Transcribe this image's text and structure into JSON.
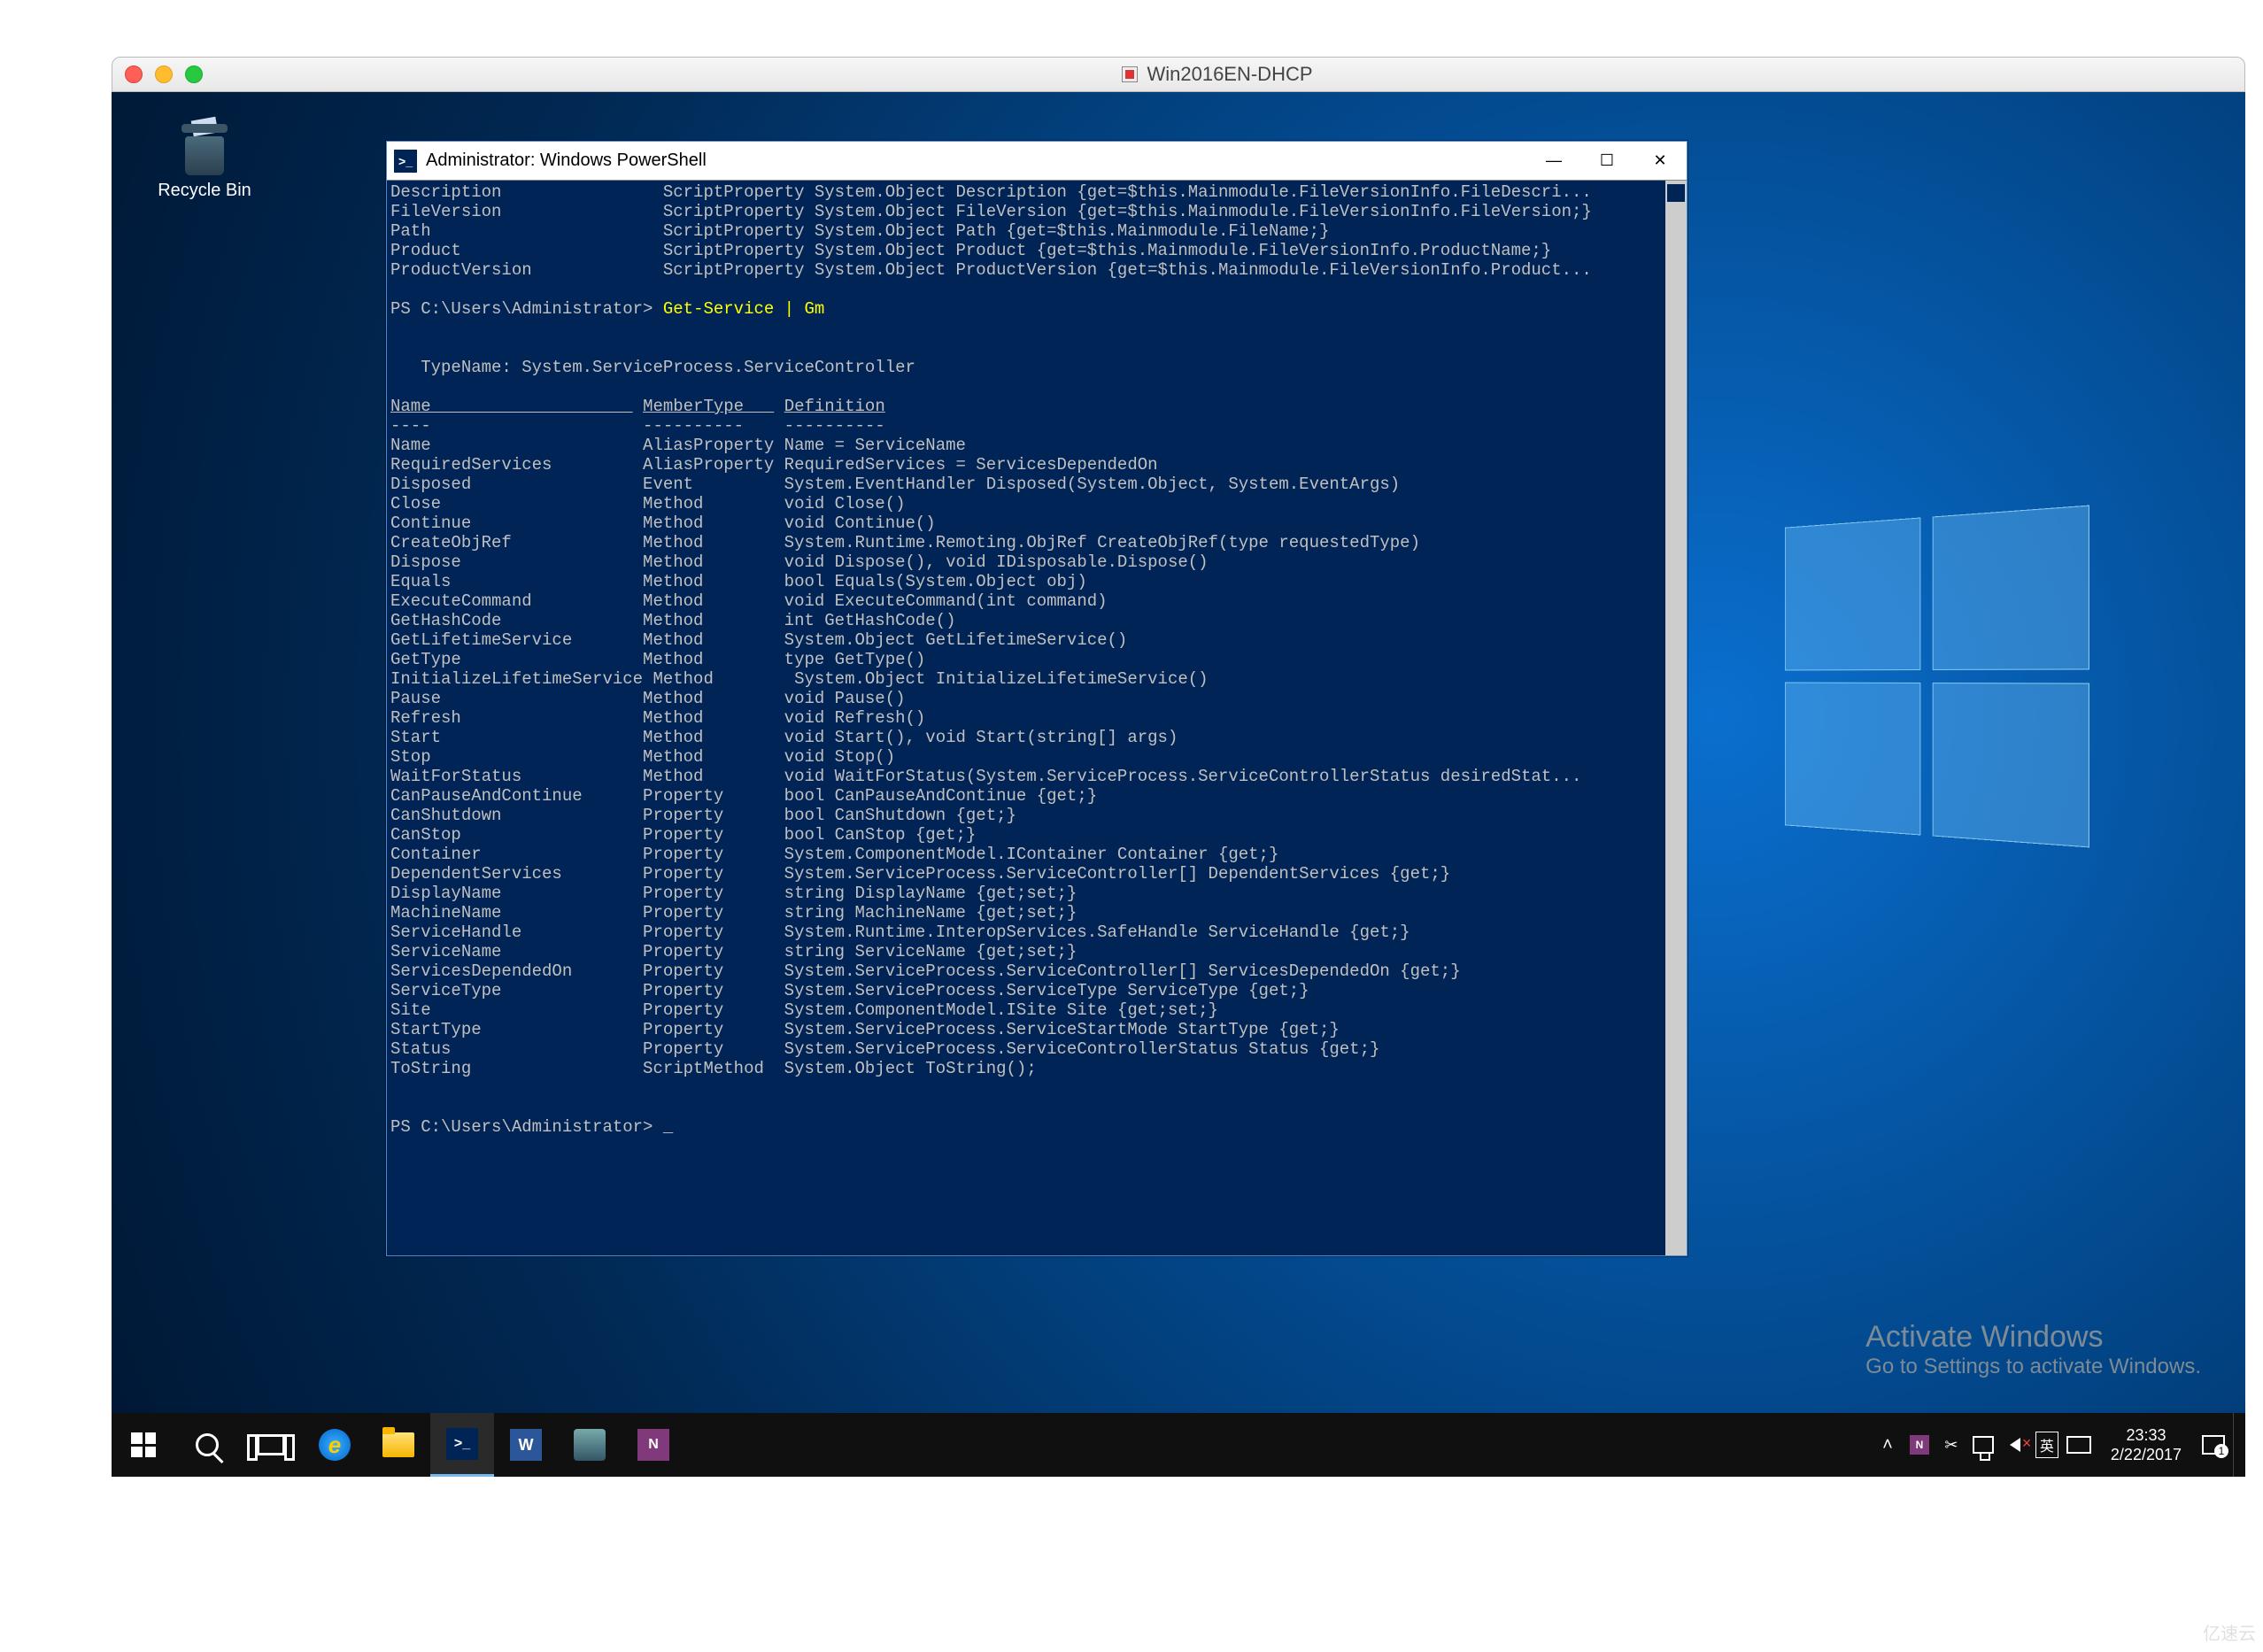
{
  "mac": {
    "title": "Win2016EN-DHCP"
  },
  "desktop": {
    "recycle_bin_label": "Recycle Bin"
  },
  "powershell": {
    "title": "Administrator: Windows PowerShell",
    "top_output": [
      {
        "name": "Description",
        "member": "ScriptProperty",
        "def": "System.Object Description {get=$this.Mainmodule.FileVersionInfo.FileDescri..."
      },
      {
        "name": "FileVersion",
        "member": "ScriptProperty",
        "def": "System.Object FileVersion {get=$this.Mainmodule.FileVersionInfo.FileVersion;}"
      },
      {
        "name": "Path",
        "member": "ScriptProperty",
        "def": "System.Object Path {get=$this.Mainmodule.FileName;}"
      },
      {
        "name": "Product",
        "member": "ScriptProperty",
        "def": "System.Object Product {get=$this.Mainmodule.FileVersionInfo.ProductName;}"
      },
      {
        "name": "ProductVersion",
        "member": "ScriptProperty",
        "def": "System.Object ProductVersion {get=$this.Mainmodule.FileVersionInfo.Product..."
      }
    ],
    "prompt1_prefix": "PS C:\\Users\\Administrator> ",
    "prompt1_cmd": "Get-Service | Gm",
    "typename_line": "   TypeName: System.ServiceProcess.ServiceController",
    "headers": {
      "name": "Name",
      "member": "MemberType",
      "def": "Definition"
    },
    "members": [
      {
        "name": "Name",
        "member": "AliasProperty",
        "def": "Name = ServiceName"
      },
      {
        "name": "RequiredServices",
        "member": "AliasProperty",
        "def": "RequiredServices = ServicesDependedOn"
      },
      {
        "name": "Disposed",
        "member": "Event",
        "def": "System.EventHandler Disposed(System.Object, System.EventArgs)"
      },
      {
        "name": "Close",
        "member": "Method",
        "def": "void Close()"
      },
      {
        "name": "Continue",
        "member": "Method",
        "def": "void Continue()"
      },
      {
        "name": "CreateObjRef",
        "member": "Method",
        "def": "System.Runtime.Remoting.ObjRef CreateObjRef(type requestedType)"
      },
      {
        "name": "Dispose",
        "member": "Method",
        "def": "void Dispose(), void IDisposable.Dispose()"
      },
      {
        "name": "Equals",
        "member": "Method",
        "def": "bool Equals(System.Object obj)"
      },
      {
        "name": "ExecuteCommand",
        "member": "Method",
        "def": "void ExecuteCommand(int command)"
      },
      {
        "name": "GetHashCode",
        "member": "Method",
        "def": "int GetHashCode()"
      },
      {
        "name": "GetLifetimeService",
        "member": "Method",
        "def": "System.Object GetLifetimeService()"
      },
      {
        "name": "GetType",
        "member": "Method",
        "def": "type GetType()"
      },
      {
        "name": "InitializeLifetimeService",
        "member": "Method",
        "def": "System.Object InitializeLifetimeService()"
      },
      {
        "name": "Pause",
        "member": "Method",
        "def": "void Pause()"
      },
      {
        "name": "Refresh",
        "member": "Method",
        "def": "void Refresh()"
      },
      {
        "name": "Start",
        "member": "Method",
        "def": "void Start(), void Start(string[] args)"
      },
      {
        "name": "Stop",
        "member": "Method",
        "def": "void Stop()"
      },
      {
        "name": "WaitForStatus",
        "member": "Method",
        "def": "void WaitForStatus(System.ServiceProcess.ServiceControllerStatus desiredStat..."
      },
      {
        "name": "CanPauseAndContinue",
        "member": "Property",
        "def": "bool CanPauseAndContinue {get;}"
      },
      {
        "name": "CanShutdown",
        "member": "Property",
        "def": "bool CanShutdown {get;}"
      },
      {
        "name": "CanStop",
        "member": "Property",
        "def": "bool CanStop {get;}"
      },
      {
        "name": "Container",
        "member": "Property",
        "def": "System.ComponentModel.IContainer Container {get;}"
      },
      {
        "name": "DependentServices",
        "member": "Property",
        "def": "System.ServiceProcess.ServiceController[] DependentServices {get;}"
      },
      {
        "name": "DisplayName",
        "member": "Property",
        "def": "string DisplayName {get;set;}"
      },
      {
        "name": "MachineName",
        "member": "Property",
        "def": "string MachineName {get;set;}"
      },
      {
        "name": "ServiceHandle",
        "member": "Property",
        "def": "System.Runtime.InteropServices.SafeHandle ServiceHandle {get;}"
      },
      {
        "name": "ServiceName",
        "member": "Property",
        "def": "string ServiceName {get;set;}"
      },
      {
        "name": "ServicesDependedOn",
        "member": "Property",
        "def": "System.ServiceProcess.ServiceController[] ServicesDependedOn {get;}"
      },
      {
        "name": "ServiceType",
        "member": "Property",
        "def": "System.ServiceProcess.ServiceType ServiceType {get;}"
      },
      {
        "name": "Site",
        "member": "Property",
        "def": "System.ComponentModel.ISite Site {get;set;}"
      },
      {
        "name": "StartType",
        "member": "Property",
        "def": "System.ServiceProcess.ServiceStartMode StartType {get;}"
      },
      {
        "name": "Status",
        "member": "Property",
        "def": "System.ServiceProcess.ServiceControllerStatus Status {get;}"
      },
      {
        "name": "ToString",
        "member": "ScriptMethod",
        "def": "System.Object ToString();"
      }
    ],
    "prompt2": "PS C:\\Users\\Administrator> _"
  },
  "activate": {
    "title": "Activate Windows",
    "sub": "Go to Settings to activate Windows."
  },
  "taskbar": {
    "ime": "英",
    "time": "23:33",
    "date": "2/22/2017",
    "notif_count": "1"
  },
  "watermark": "亿速云"
}
